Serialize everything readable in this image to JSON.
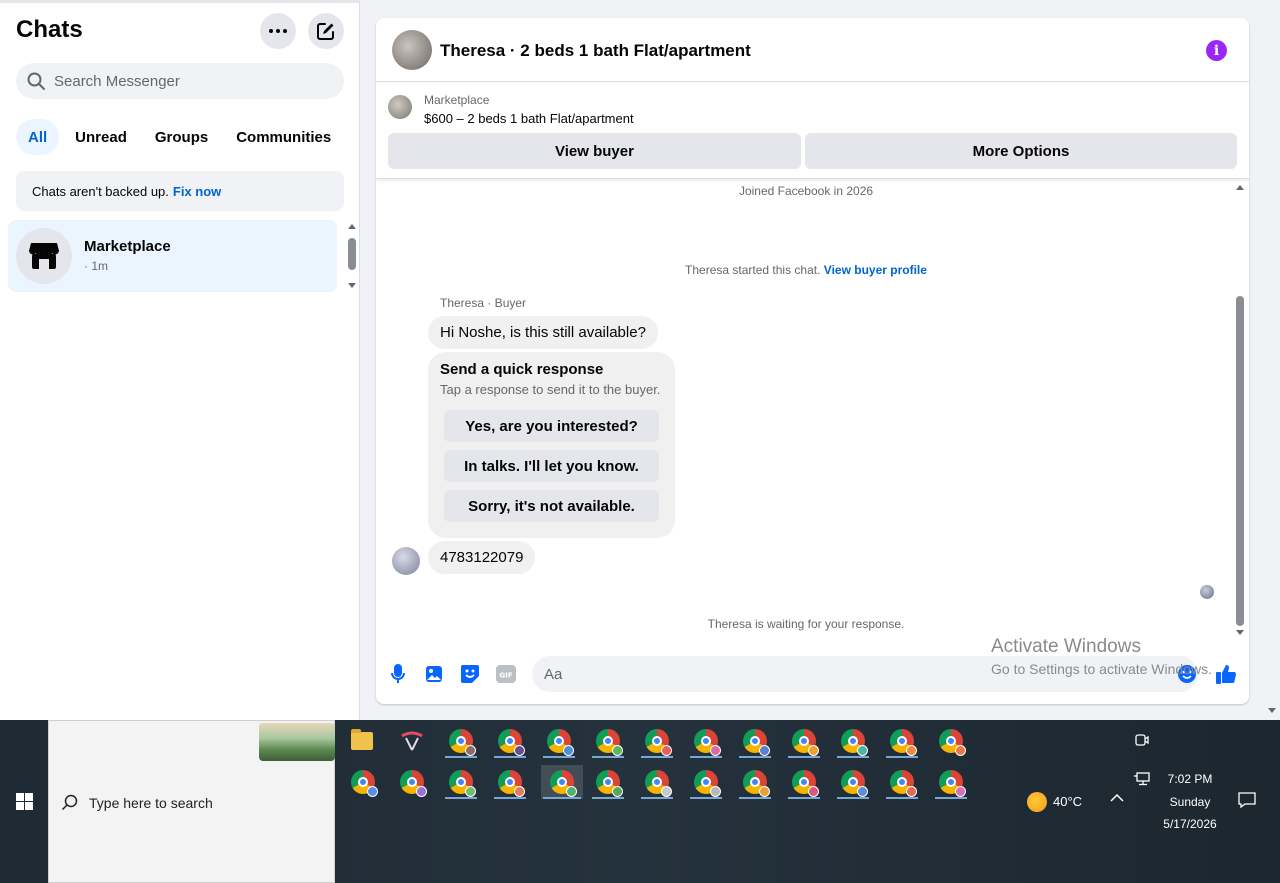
{
  "sidebar": {
    "title": "Chats",
    "search_placeholder": "Search Messenger",
    "tabs": [
      {
        "label": "All",
        "active": true
      },
      {
        "label": "Unread",
        "active": false
      },
      {
        "label": "Groups",
        "active": false
      },
      {
        "label": "Communities",
        "active": false
      }
    ],
    "backup_note": {
      "text": "Chats aren't backed up.",
      "link": "Fix now"
    },
    "chats": [
      {
        "name": "Marketplace",
        "time": "· 1m",
        "selected": true
      }
    ]
  },
  "conversation": {
    "title": "Theresa · 2 beds 1 bath Flat/apartment",
    "listing": {
      "source": "Marketplace",
      "price_title": "$600 – 2 beds 1 bath Flat/apartment",
      "view_buyer": "View buyer",
      "more_options": "More Options"
    },
    "joined": "Joined Facebook in 2026",
    "started": {
      "text": "Theresa started this chat.",
      "link": "View buyer profile"
    },
    "sender_label": "Theresa · Buyer",
    "messages": [
      "Hi Noshe, is this still available?",
      "4783122079"
    ],
    "quick_response": {
      "title": "Send a quick response",
      "subtitle": "Tap a response to send it to the buyer.",
      "options": [
        "Yes, are you interested?",
        "In talks. I'll let you know.",
        "Sorry, it's not available."
      ]
    },
    "waiting": "Theresa is waiting for your response.",
    "composer_placeholder": "Aa"
  },
  "watermark": {
    "line1": "Activate Windows",
    "line2": "Go to Settings to activate Windows."
  },
  "taskbar": {
    "search_placeholder": "Type here to search",
    "weather": "40°C",
    "time": "7:02 PM",
    "day": "Sunday",
    "date": "5/17/2026"
  },
  "colors": {
    "accent": "#0064d1",
    "messenger_purple": "#9b27f5",
    "selected_bg": "#ebf5ff"
  }
}
